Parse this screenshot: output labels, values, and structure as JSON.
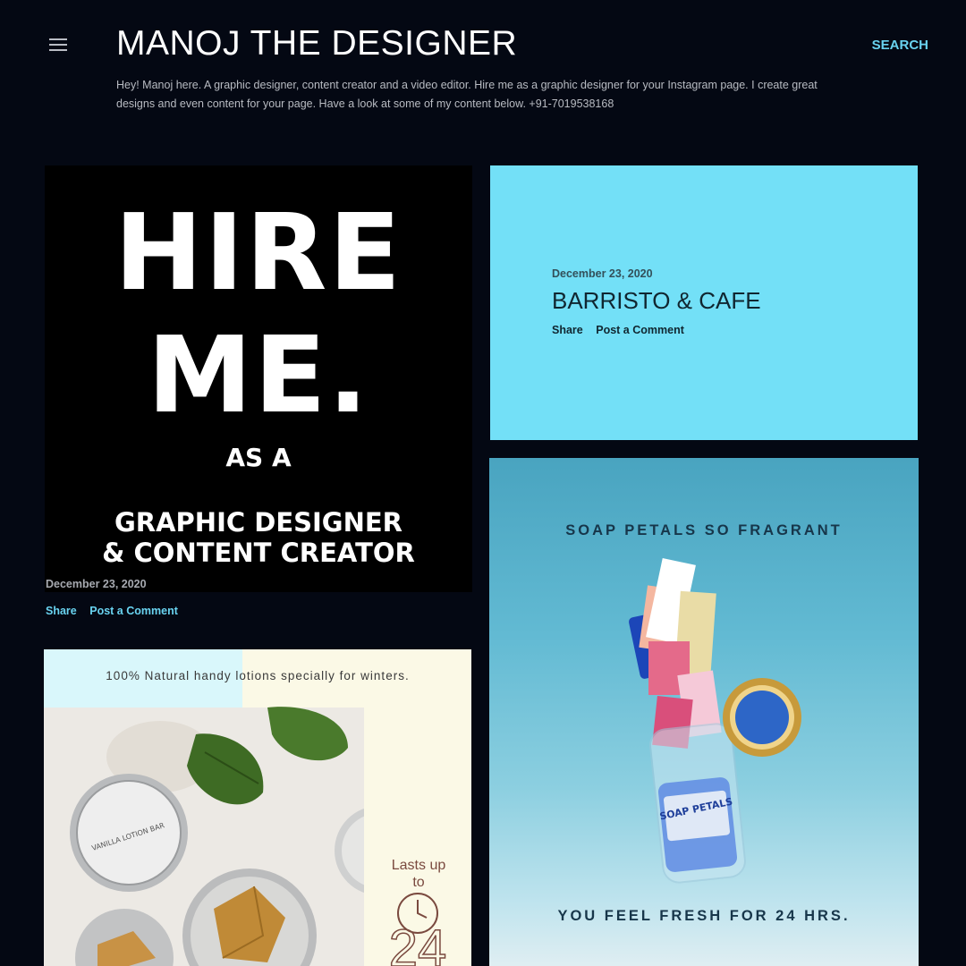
{
  "header": {
    "title": "MANOJ THE DESIGNER",
    "search_label": "SEARCH",
    "description": "Hey! Manoj here. A graphic designer, content creator and a video editor. Hire me as a graphic designer for your Instagram page. I create great designs and even content for your page. Have a look at some of my content below. +91-7019538168"
  },
  "posts": [
    {
      "image_text": [
        "HIRE",
        "ME.",
        "AS A",
        "GRAPHIC DESIGNER",
        "& CONTENT CREATOR"
      ],
      "date": "December 23, 2020",
      "share_label": "Share",
      "comment_label": "Post a Comment"
    },
    {
      "date": "December 23, 2020",
      "title": "BARRISTO & CAFE",
      "share_label": "Share",
      "comment_label": "Post a Comment"
    },
    {
      "image_text": [
        "SOAP PETALS SO FRAGRANT",
        "YOU FEEL FRESH FOR 24 HRS.",
        "SOAP PETALS"
      ]
    },
    {
      "image_text": [
        "100% Natural handy lotions specially for winters.",
        "Lasts up",
        "to",
        "24",
        "VANILLA LOTION BAR"
      ]
    }
  ],
  "colors": {
    "background": "#040813",
    "accent": "#69d3f0",
    "barristo_card": "#73e0f7"
  },
  "icons": {
    "menu": "hamburger-menu-icon"
  }
}
